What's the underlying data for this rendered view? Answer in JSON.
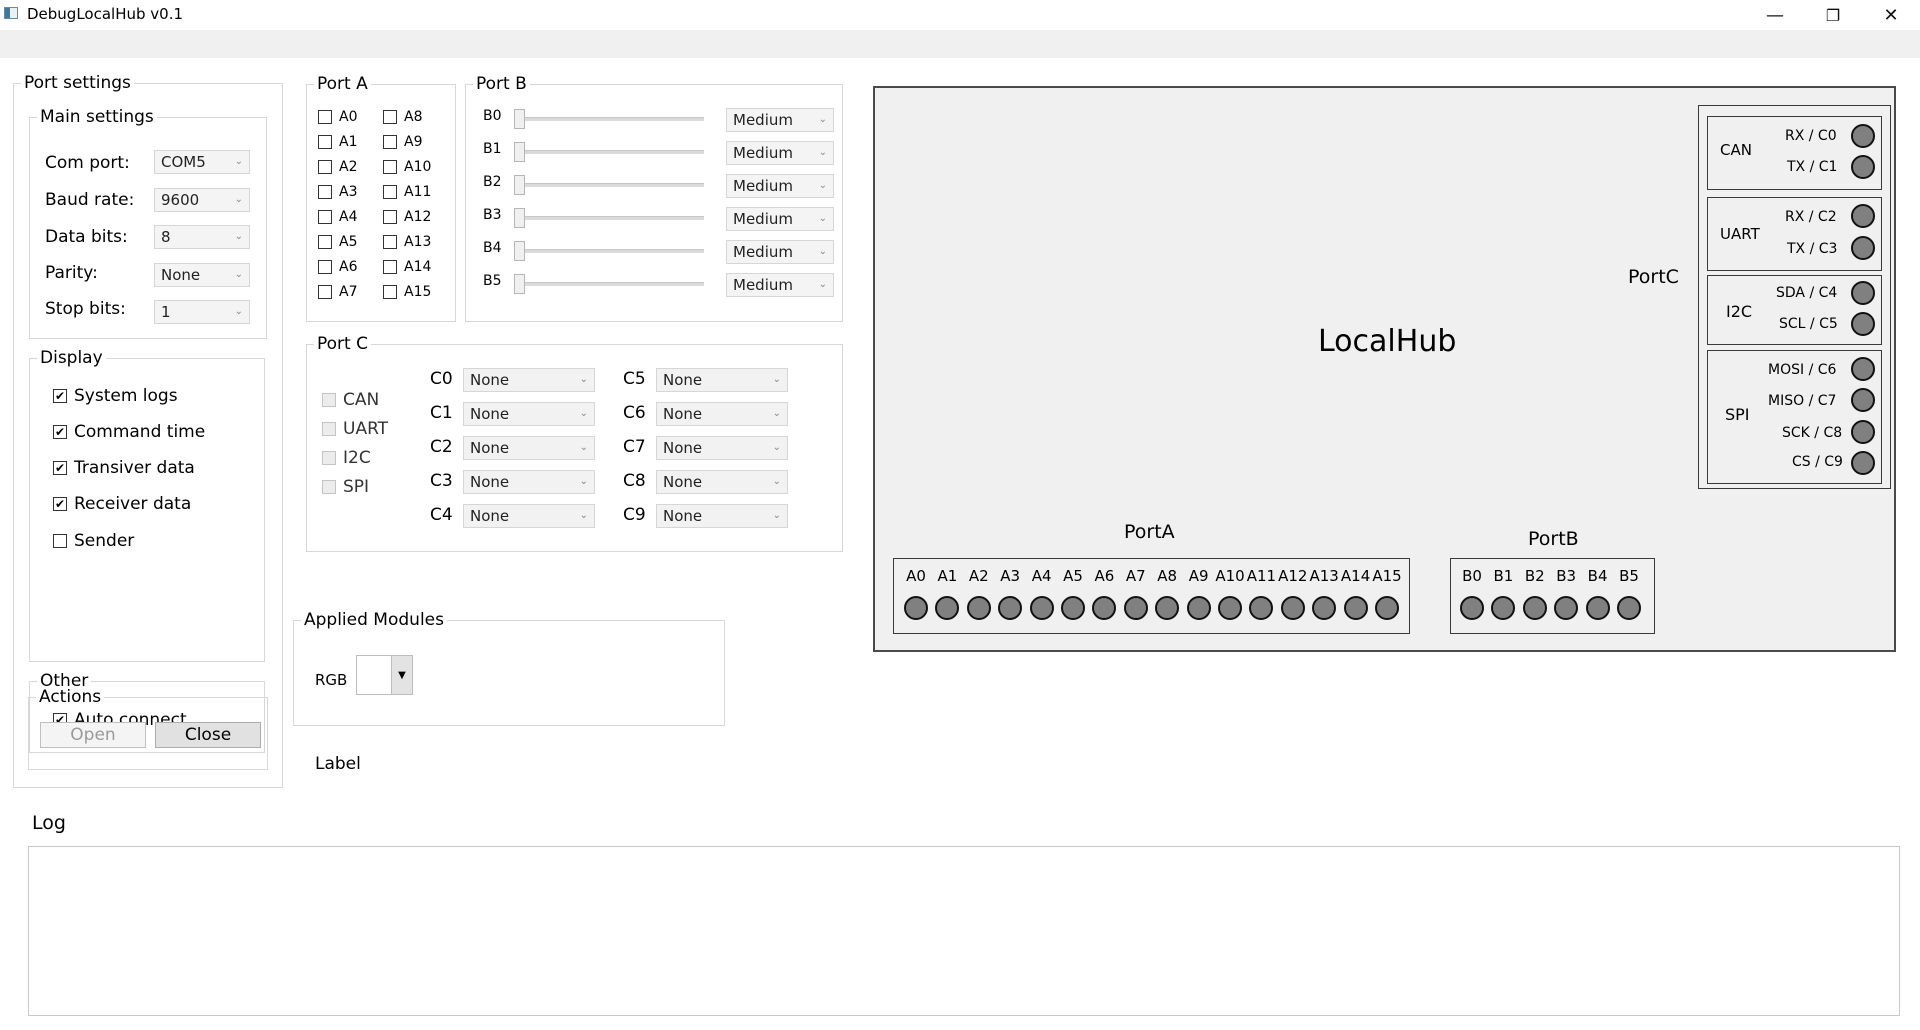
{
  "window": {
    "title": "DebugLocalHub v0.1",
    "minimize": "—",
    "maximize": "❐",
    "close": "✕"
  },
  "port_settings": {
    "title": "Port settings",
    "main_settings": {
      "title": "Main settings",
      "com_port": {
        "label": "Com port:",
        "value": "COM5"
      },
      "baud_rate": {
        "label": "Baud rate:",
        "value": "9600"
      },
      "data_bits": {
        "label": "Data bits:",
        "value": "8"
      },
      "parity": {
        "label": "Parity:",
        "value": "None"
      },
      "stop_bits": {
        "label": "Stop bits:",
        "value": "1"
      }
    },
    "display": {
      "title": "Display",
      "items": [
        {
          "label": "System logs",
          "checked": true
        },
        {
          "label": "Command time",
          "checked": true
        },
        {
          "label": "Transiver data",
          "checked": true
        },
        {
          "label": "Receiver data",
          "checked": true
        },
        {
          "label": "Sender",
          "checked": false
        }
      ]
    },
    "other": {
      "title": "Other",
      "items": [
        {
          "label": "Auto connect",
          "checked": true
        }
      ]
    },
    "actions": {
      "title": "Actions",
      "open_label": "Open",
      "close_label": "Close"
    }
  },
  "port_a": {
    "title": "Port A",
    "pins": [
      "A0",
      "A1",
      "A2",
      "A3",
      "A4",
      "A5",
      "A6",
      "A7",
      "A8",
      "A9",
      "A10",
      "A11",
      "A12",
      "A13",
      "A14",
      "A15"
    ]
  },
  "port_b": {
    "title": "Port B",
    "rows": [
      {
        "label": "B0",
        "speed": "Medium",
        "level": 0
      },
      {
        "label": "B1",
        "speed": "Medium",
        "level": 0
      },
      {
        "label": "B2",
        "speed": "Medium",
        "level": 0
      },
      {
        "label": "B3",
        "speed": "Medium",
        "level": 0
      },
      {
        "label": "B4",
        "speed": "Medium",
        "level": 0
      },
      {
        "label": "B5",
        "speed": "Medium",
        "level": 0
      }
    ]
  },
  "port_c": {
    "title": "Port C",
    "modules": [
      "CAN",
      "UART",
      "I2C",
      "SPI"
    ],
    "pins": [
      {
        "label": "C0",
        "value": "None"
      },
      {
        "label": "C1",
        "value": "None"
      },
      {
        "label": "C2",
        "value": "None"
      },
      {
        "label": "C3",
        "value": "None"
      },
      {
        "label": "C4",
        "value": "None"
      },
      {
        "label": "C5",
        "value": "None"
      },
      {
        "label": "C6",
        "value": "None"
      },
      {
        "label": "C7",
        "value": "None"
      },
      {
        "label": "C8",
        "value": "None"
      },
      {
        "label": "C9",
        "value": "None"
      }
    ]
  },
  "applied_modules": {
    "title": "Applied Modules",
    "rgb_label": "RGB",
    "rgb_value": ""
  },
  "label_text": "Label",
  "hub": {
    "title": "LocalHub",
    "port_c_title": "PortC",
    "port_a_title": "PortA",
    "port_b_title": "PortB",
    "can": {
      "name": "CAN",
      "pins": [
        "RX / C0",
        "TX / C1"
      ]
    },
    "uart": {
      "name": "UART",
      "pins": [
        "RX / C2",
        "TX / C3"
      ]
    },
    "i2c": {
      "name": "I2C",
      "pins": [
        "SDA / C4",
        "SCL / C5"
      ]
    },
    "spi": {
      "name": "SPI",
      "pins": [
        "MOSI / C6",
        "MISO / C7",
        "SCK / C8",
        "CS / C9"
      ]
    },
    "port_a_pins": [
      "A0",
      "A1",
      "A2",
      "A3",
      "A4",
      "A5",
      "A6",
      "A7",
      "A8",
      "A9",
      "A10",
      "A11",
      "A12",
      "A13",
      "A14",
      "A15"
    ],
    "port_b_pins": [
      "B0",
      "B1",
      "B2",
      "B3",
      "B4",
      "B5"
    ]
  },
  "log": {
    "title": "Log",
    "content": ""
  }
}
